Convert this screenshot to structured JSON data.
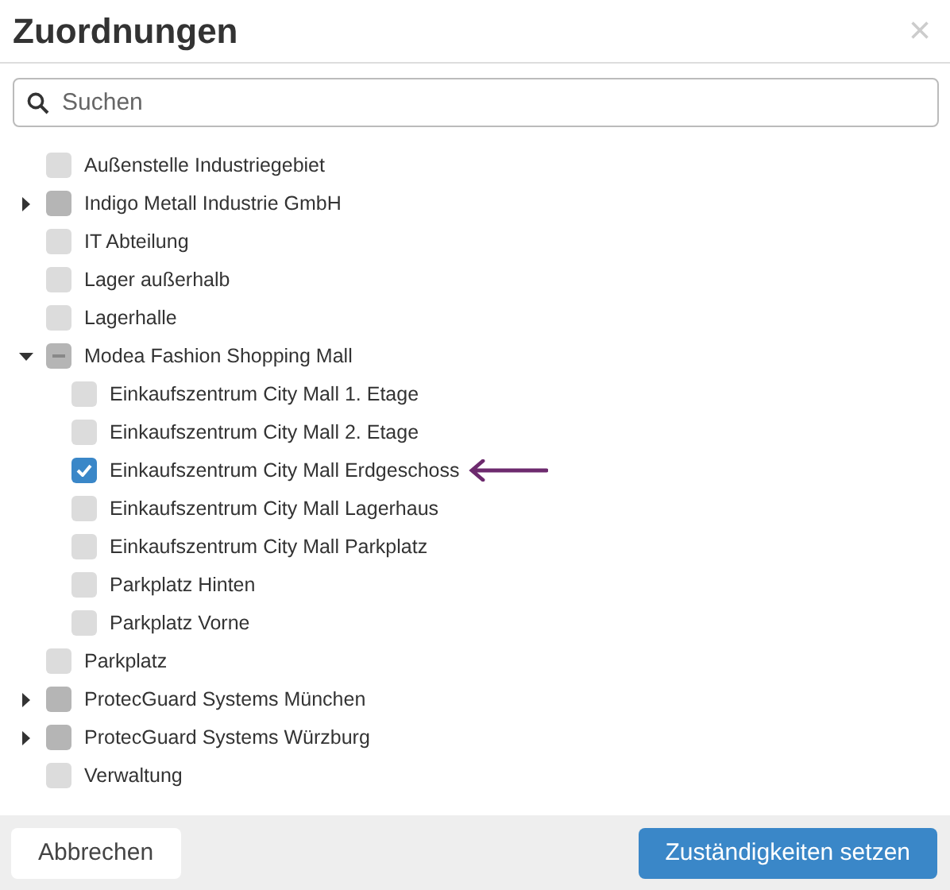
{
  "dialog": {
    "title": "Zuordnungen",
    "close": "×"
  },
  "search": {
    "placeholder": "Suchen"
  },
  "tree": [
    {
      "label": "Außenstelle Industriegebiet",
      "checked": false,
      "pointed": false
    },
    {
      "label": "Indigo Metall Industrie GmbH",
      "checked": false,
      "partial": false,
      "pointed": false,
      "expanded": false
    },
    {
      "label": "IT Abteilung",
      "checked": false,
      "pointed": false
    },
    {
      "label": "Lager außerhalb",
      "checked": false,
      "pointed": false
    },
    {
      "label": "Lagerhalle",
      "checked": false,
      "pointed": false
    },
    {
      "label": "Modea Fashion Shopping Mall",
      "checked": false,
      "partial": true,
      "pointed": false,
      "expanded": true,
      "children": [
        {
          "label": "Einkaufszentrum City Mall 1. Etage",
          "checked": false,
          "pointed": false
        },
        {
          "label": "Einkaufszentrum City Mall 2. Etage",
          "checked": false,
          "pointed": false
        },
        {
          "label": "Einkaufszentrum City Mall Erdgeschoss",
          "checked": true,
          "pointed": true
        },
        {
          "label": "Einkaufszentrum City Mall Lagerhaus",
          "checked": false,
          "pointed": false
        },
        {
          "label": "Einkaufszentrum City Mall Parkplatz",
          "checked": false,
          "pointed": false
        },
        {
          "label": "Parkplatz Hinten",
          "checked": false,
          "pointed": false
        },
        {
          "label": "Parkplatz Vorne",
          "checked": false,
          "pointed": false
        }
      ]
    },
    {
      "label": "Parkplatz",
      "checked": false,
      "pointed": false
    },
    {
      "label": "ProtecGuard Systems München",
      "checked": false,
      "partial": false,
      "pointed": false,
      "expanded": false
    },
    {
      "label": "ProtecGuard Systems Würzburg",
      "checked": false,
      "partial": false,
      "pointed": false,
      "expanded": false
    },
    {
      "label": "Verwaltung",
      "checked": false,
      "pointed": false
    }
  ],
  "buttons": [
    {
      "label": "Abbrechen",
      "kind": "secondary"
    },
    {
      "label": "Zuständigkeiten setzen",
      "kind": "primary"
    }
  ]
}
